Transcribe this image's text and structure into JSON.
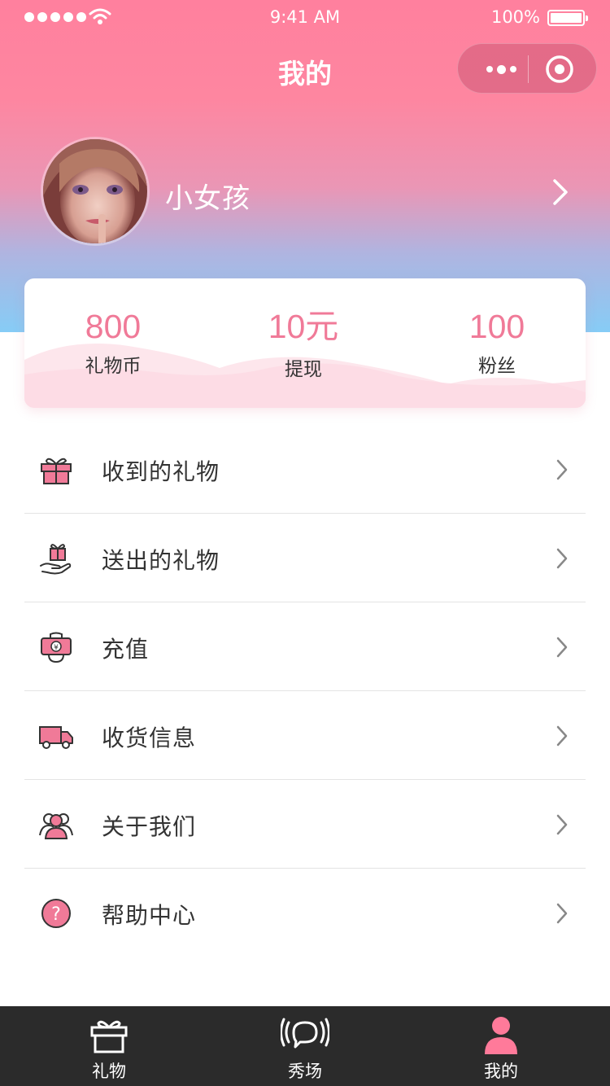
{
  "status_bar": {
    "time": "9:41 AM",
    "battery": "100%"
  },
  "nav": {
    "title": "我的"
  },
  "profile": {
    "username": "小女孩"
  },
  "stats": [
    {
      "value": "800",
      "label": "礼物币"
    },
    {
      "value": "10元",
      "label": "提现"
    },
    {
      "value": "100",
      "label": "粉丝"
    }
  ],
  "menu": [
    {
      "label": "收到的礼物",
      "icon": "gift-box-icon"
    },
    {
      "label": "送出的礼物",
      "icon": "gift-hand-icon"
    },
    {
      "label": "充值",
      "icon": "recharge-icon"
    },
    {
      "label": "收货信息",
      "icon": "delivery-truck-icon"
    },
    {
      "label": "关于我们",
      "icon": "users-icon"
    },
    {
      "label": "帮助中心",
      "icon": "help-icon"
    }
  ],
  "tabbar": [
    {
      "label": "礼物",
      "icon": "gift-tab-icon"
    },
    {
      "label": "秀场",
      "icon": "broadcast-tab-icon"
    },
    {
      "label": "我的",
      "icon": "profile-tab-icon",
      "active": true
    }
  ],
  "colors": {
    "accent": "#f07a98",
    "tabbar_bg": "#2b2b2b",
    "active_tab_icon": "#ff7a9a"
  }
}
